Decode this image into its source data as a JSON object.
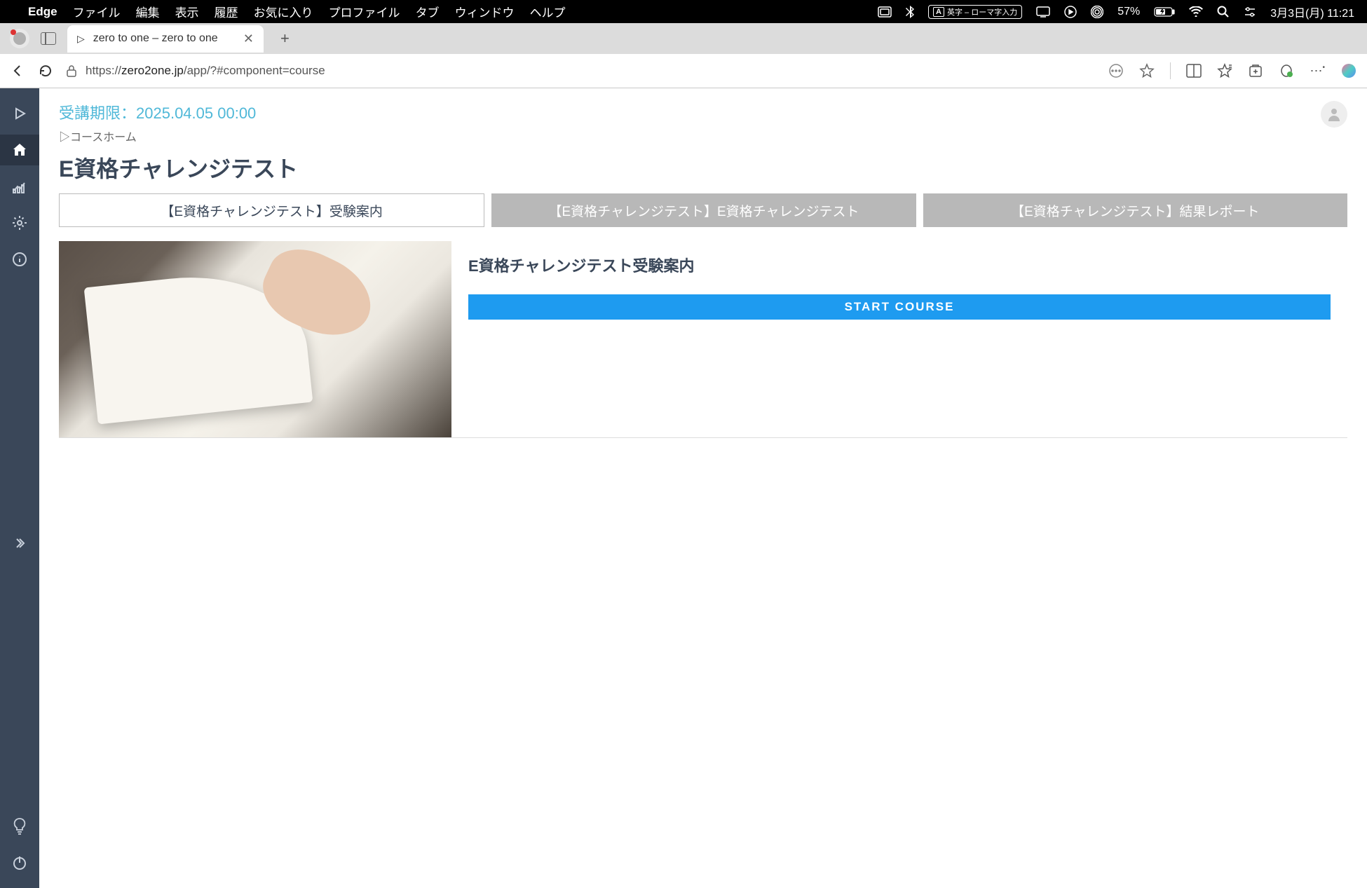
{
  "menubar": {
    "app": "Edge",
    "items": [
      "ファイル",
      "編集",
      "表示",
      "履歴",
      "お気に入り",
      "プロファイル",
      "タブ",
      "ウィンドウ",
      "ヘルプ"
    ],
    "ime": "英字 – ローマ字入力",
    "battery": "57%",
    "datetime": "3月3日(月)  11:21"
  },
  "browser": {
    "tab_title": "zero to one – zero to one",
    "url_proto": "https://",
    "url_domain": "zero2one.jp",
    "url_path": "/app/?#component=course"
  },
  "page": {
    "deadline_label": "受講期限：",
    "deadline_value": "2025.04.05 00:00",
    "breadcrumb": "▷コースホーム",
    "title": "E資格チャレンジテスト",
    "tabs": [
      "【E資格チャレンジテスト】受験案内",
      "【E資格チャレンジテスト】E資格チャレンジテスト",
      "【E資格チャレンジテスト】結果レポート"
    ],
    "course_subtitle": "E資格チャレンジテスト受験案内",
    "start_button": "START COURSE"
  }
}
